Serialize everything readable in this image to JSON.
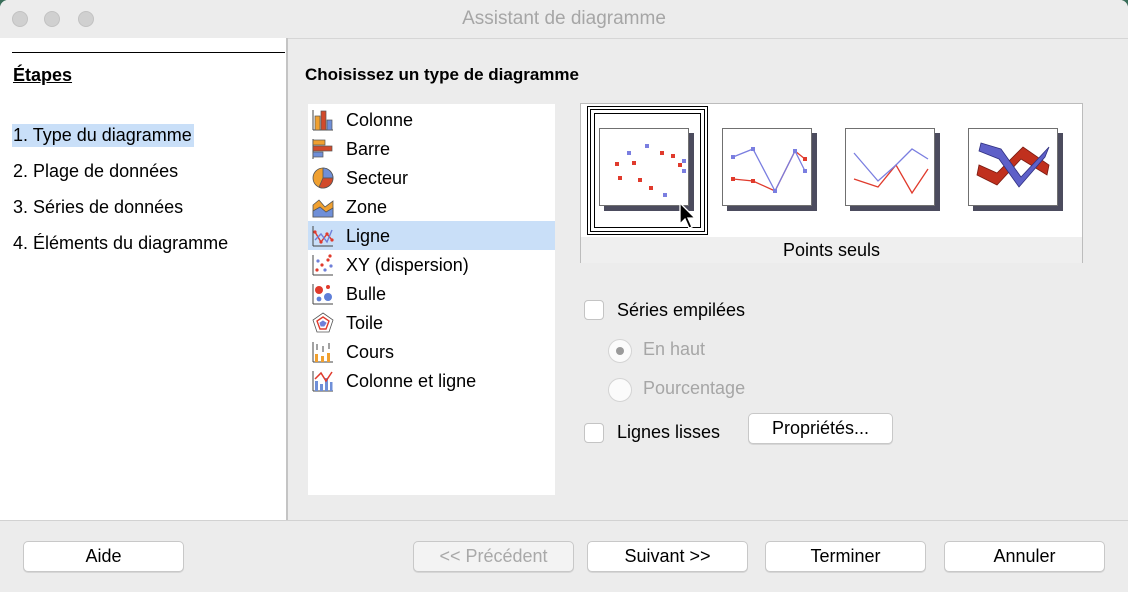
{
  "window": {
    "title": "Assistant de diagramme"
  },
  "steps": {
    "heading": "Étapes",
    "items": [
      {
        "label": "1. Type du diagramme",
        "selected": true
      },
      {
        "label": "2. Plage de données",
        "selected": false
      },
      {
        "label": "3. Séries de données",
        "selected": false
      },
      {
        "label": "4. Éléments du diagramme",
        "selected": false
      }
    ]
  },
  "main": {
    "title": "Choisissez un type de diagramme",
    "chart_types": [
      {
        "label": "Colonne",
        "icon": "column-chart-icon"
      },
      {
        "label": "Barre",
        "icon": "bar-chart-icon"
      },
      {
        "label": "Secteur",
        "icon": "pie-chart-icon"
      },
      {
        "label": "Zone",
        "icon": "area-chart-icon"
      },
      {
        "label": "Ligne",
        "icon": "line-chart-icon",
        "selected": true
      },
      {
        "label": "XY (dispersion)",
        "icon": "scatter-chart-icon"
      },
      {
        "label": "Bulle",
        "icon": "bubble-chart-icon"
      },
      {
        "label": "Toile",
        "icon": "net-chart-icon"
      },
      {
        "label": "Cours",
        "icon": "stock-chart-icon"
      },
      {
        "label": "Colonne et ligne",
        "icon": "column-line-chart-icon"
      }
    ],
    "variants": {
      "selected_caption": "Points seuls",
      "items": [
        {
          "name": "points-only-variant",
          "selected": true
        },
        {
          "name": "points-and-lines-variant",
          "selected": false
        },
        {
          "name": "lines-only-variant",
          "selected": false
        },
        {
          "name": "3d-lines-variant",
          "selected": false
        }
      ]
    },
    "options": {
      "stacked_series": "Séries empilées",
      "on_top": "En haut",
      "percent": "Pourcentage",
      "smooth_lines": "Lignes lisses",
      "properties_button": "Propriétés..."
    }
  },
  "footer": {
    "help": "Aide",
    "previous": "<< Précédent",
    "next": "Suivant >>",
    "finish": "Terminer",
    "cancel": "Annuler"
  },
  "colors": {
    "selection": "#c9dff8",
    "series_red": "#e03a2c",
    "series_blue": "#7a7ee0"
  }
}
